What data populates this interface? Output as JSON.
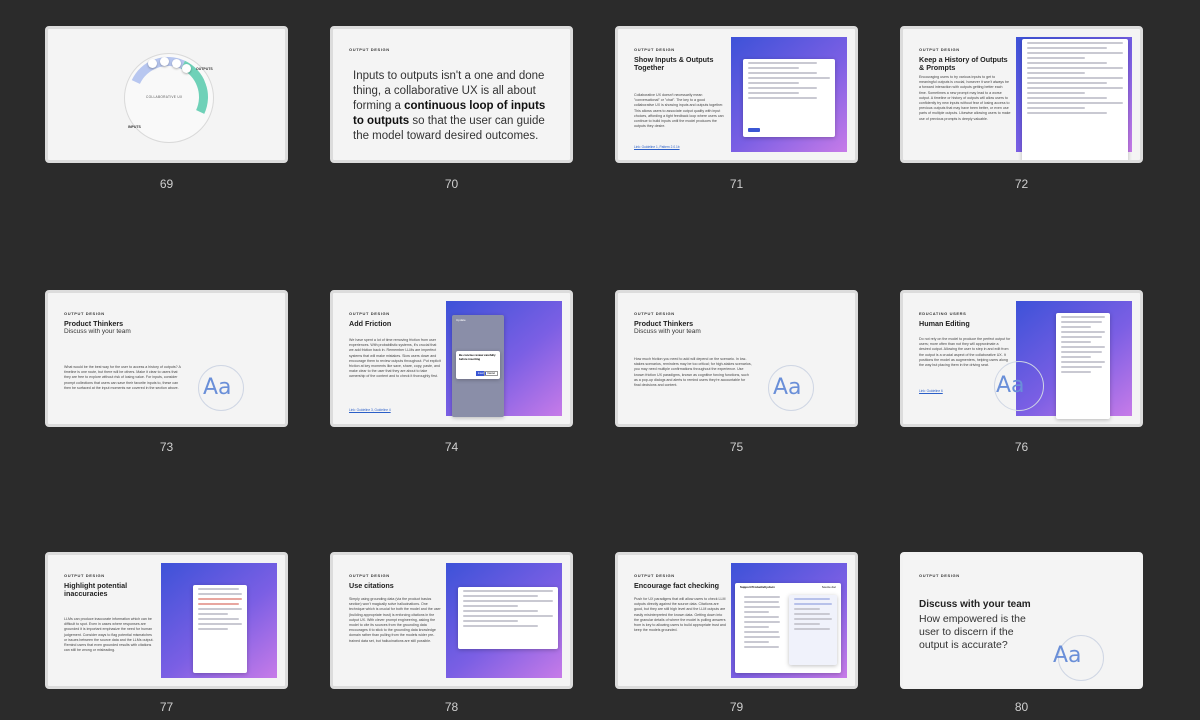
{
  "slides": [
    {
      "number": "69",
      "eyebrow": "",
      "title": "",
      "labels": {
        "outputs": "OUTPUTS",
        "inputs": "INPUTS",
        "center": "COLLABORATIVE UX"
      }
    },
    {
      "number": "70",
      "eyebrow": "OUTPUT DESIGN",
      "text_pre": "Inputs to outputs isn't a one and done thing, a collaborative UX is all about forming a ",
      "text_bold": "continuous loop of inputs to outputs",
      "text_post": " so that the user can guide the model toward desired outcomes."
    },
    {
      "number": "71",
      "eyebrow": "OUTPUT DESIGN",
      "title": "Show Inputs & Outputs Together",
      "body": "Collaborative UX doesn't necessarily mean \"conversational\" or \"chat\". The key to a good collaborative UX is showing inputs and outputs together. This allows users to associate output quality with input choices, affording a tight feedback loop where users can continue to build inputs until the model produces the outputs they desire.",
      "link": "Link: Guideline 1, Pattern 2.0.1b"
    },
    {
      "number": "72",
      "eyebrow": "OUTPUT DESIGN",
      "title": "Keep a History of Outputs & Prompts",
      "body": "Encouraging users to try various inputs to get to meaningful outputs is crucial, however it won't always be a forward interaction with outputs getting better each time. Sometimes a new prompt may lead to a worse output. A timeline or history of outputs will allow users to confidently try new inputs without fear of losing access to previous outputs that may have been better, or even use parts of multiple outputs. Likewise allowing users to make use of previous prompts is deeply valuable."
    },
    {
      "number": "73",
      "eyebrow": "OUTPUT DESIGN",
      "title": "Product Thinkers",
      "subtitle": "Discuss with your team",
      "body": "What would be the best way for the user to access a history of outputs? A timeline is one route, but there will be others. Make it clear to users that they are free to explore without risk of losing value. For inputs, consider prompt collections that users can save their favorite inputs to, these can then be surfaced at the input moments we covered in the section above.",
      "aa": "Aa"
    },
    {
      "number": "74",
      "eyebrow": "OUTPUT DESIGN",
      "title": "Add Friction",
      "body": "We have spent a lot of time removing friction from user experiences. With probabilistic systems, it's crucial that we add friction back in. Remember LLMs are imperfect systems that will make mistakes. Slow users down and encourage them to review outputs throughout. Put explicit friction at key moments like save, share, copy, paste, and make clear to the user that they are about to take ownership of the content and to check it thoroughly first.",
      "link": "Link: Guideline 3, Guideline 4",
      "dialog": {
        "header": "Update",
        "title": "Be concise review carefully before inserting",
        "confirm": "Insert",
        "cancel": "Cancel"
      }
    },
    {
      "number": "75",
      "eyebrow": "OUTPUT DESIGN",
      "title": "Product Thinkers",
      "subtitle": "Discuss with your team",
      "body": "How much friction you need to add will depend on the scenario. In low-stakes scenarios, reminders may be too critical; for high-stakes scenarios, you may need multiple confirmations throughout the experience. Use known friction UX paradigms, known as cognitive forcing functions, such as a pop-up dialogs and alerts to remind users they're accountable for final decisions and content.",
      "aa": "Aa"
    },
    {
      "number": "76",
      "eyebrow": "EDUCATING USERS",
      "title": "Human Editing",
      "body": "Do not rely on the model to produce the perfect output for users; more often than not they will approximate a desired output. Allowing the user to step in and edit from the output is a crucial aspect of the collaborative UX. It positions the model as augmenters, helping users along the way but placing them in the driving seat.",
      "link": "Link: Guideline 6",
      "aa": "Aa"
    },
    {
      "number": "77",
      "eyebrow": "OUTPUT DESIGN",
      "title": "Highlight potential inaccuracies",
      "body": "LLMs can produce inaccurate information which can be difficult to spot. Even in cases where responses are grounded it is important emphasize the need for human judgement. Consider ways to flag potential mismatches or issues between the source data and the LLMs output. Remind users that even grounded results with citations can still be wrong or misleading."
    },
    {
      "number": "78",
      "eyebrow": "OUTPUT DESIGN",
      "title": "Use citations",
      "body": "Simply using grounding data (via the product basics section) won't magically solve hallucinations. One technique which is crucial for both the model and the user (building appropriate trust) is enforcing citations in the output UX. With clever prompt engineering, asking the model to cite its sources from the grounding data encourages it to stick to the grounding data knowledge domain rather than pulling from the models wider pre-trained data set, but hallucinations are still possible."
    },
    {
      "number": "79",
      "eyebrow": "OUTPUT DESIGN",
      "title": "Encourage fact checking",
      "body": "Push for UX paradigms that will allow users to check LLM outputs directly against the source data. Citations are good, but they are still high level and the LLM outputs are easily misinterpreted the known data. Getting down into the granular details of where the model is pulling answers from is key to allowing users to build appropriate trust and keep the models grounded.",
      "doc_title": "Support Productivity.docx",
      "doc_tab": "Source doc"
    },
    {
      "number": "80",
      "eyebrow": "OUTPUT DESIGN",
      "title": "Discuss with your team",
      "question": "How empowered is the user to discern if the output is accurate?",
      "aa": "Aa"
    }
  ]
}
